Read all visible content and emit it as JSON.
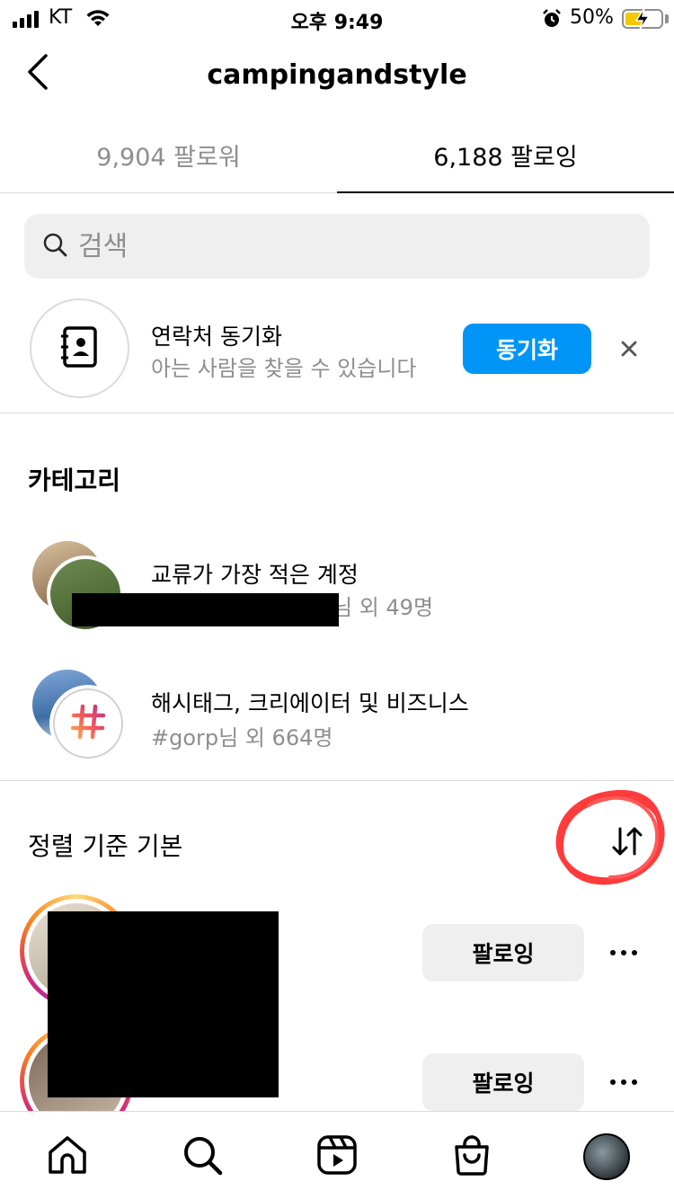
{
  "status_bar": {
    "carrier": "KT",
    "time": "오후 9:49",
    "battery": "50%",
    "battery_level": 0.5
  },
  "header": {
    "title": "campingandstyle"
  },
  "tabs": [
    {
      "label": "9,904 팔로워",
      "active": false
    },
    {
      "label": "6,188 팔로잉",
      "active": true
    }
  ],
  "search": {
    "placeholder": "검색"
  },
  "contact_sync": {
    "title": "연락처 동기화",
    "subtitle": "아는 사람을 찾을 수 있습니다",
    "button": "동기화"
  },
  "categories": {
    "title": "카테고리",
    "items": [
      {
        "title": "교류가 가장 적은 계정",
        "subtitle_suffix": "님 외 49명"
      },
      {
        "title": "해시태그, 크리에이터 및 비즈니스",
        "subtitle": "#gorp님 외 664명"
      }
    ]
  },
  "sort": {
    "label": "정렬 기준 기본"
  },
  "following_list": [
    {
      "button": "팔로잉"
    },
    {
      "button": "팔로잉"
    }
  ],
  "colors": {
    "accent": "#0095f6",
    "secondary_text": "#8e8e8e",
    "annotation": "#ff3b3b"
  },
  "bottom_nav": [
    "home-icon",
    "search-icon",
    "reels-icon",
    "shop-icon",
    "profile-avatar"
  ]
}
